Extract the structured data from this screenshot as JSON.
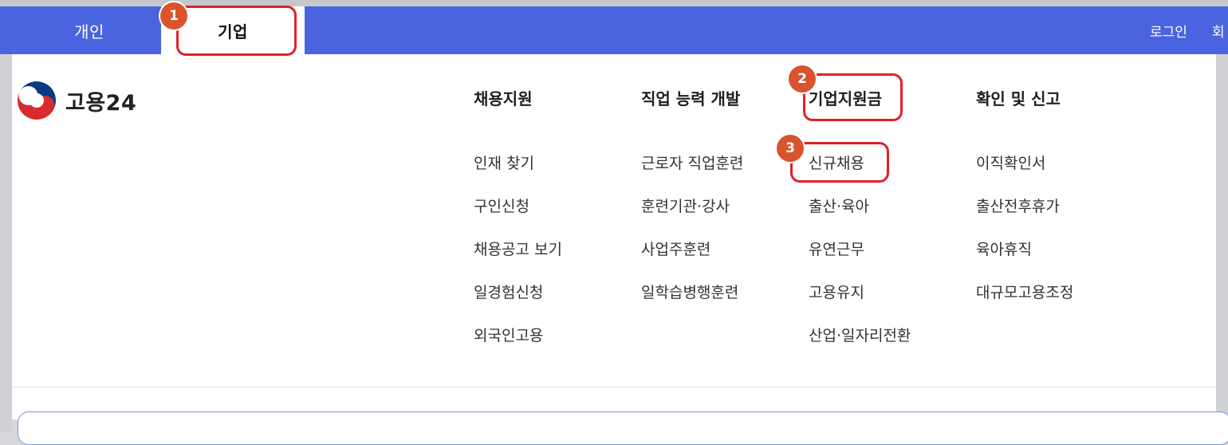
{
  "topbar": {
    "tabs": [
      {
        "label": "개인"
      },
      {
        "label": "기업"
      }
    ],
    "login": "로그인",
    "signup_partial": "회"
  },
  "logo": {
    "text": "고용24",
    "icon": "taegeuk-logo-icon"
  },
  "menu": {
    "columns": [
      {
        "header": "채용지원",
        "items": [
          "인재 찾기",
          "구인신청",
          "채용공고 보기",
          "일경험신청",
          "외국인고용"
        ]
      },
      {
        "header": "직업 능력 개발",
        "items": [
          "근로자 직업훈련",
          "훈련기관·강사",
          "사업주훈련",
          "일학습병행훈련"
        ]
      },
      {
        "header": "기업지원금",
        "items": [
          "신규채용",
          "출산·육아",
          "유연근무",
          "고용유지",
          "산업·일자리전환"
        ]
      },
      {
        "header": "확인 및 신고",
        "items": [
          "이직확인서",
          "출산전후휴가",
          "육아휴직",
          "대규모고용조정"
        ]
      }
    ]
  },
  "annotations": {
    "badges": [
      "1",
      "2",
      "3"
    ],
    "color": "#e02028",
    "badge_color": "#d9542c"
  },
  "colors": {
    "topbar": "#4a64e0"
  }
}
